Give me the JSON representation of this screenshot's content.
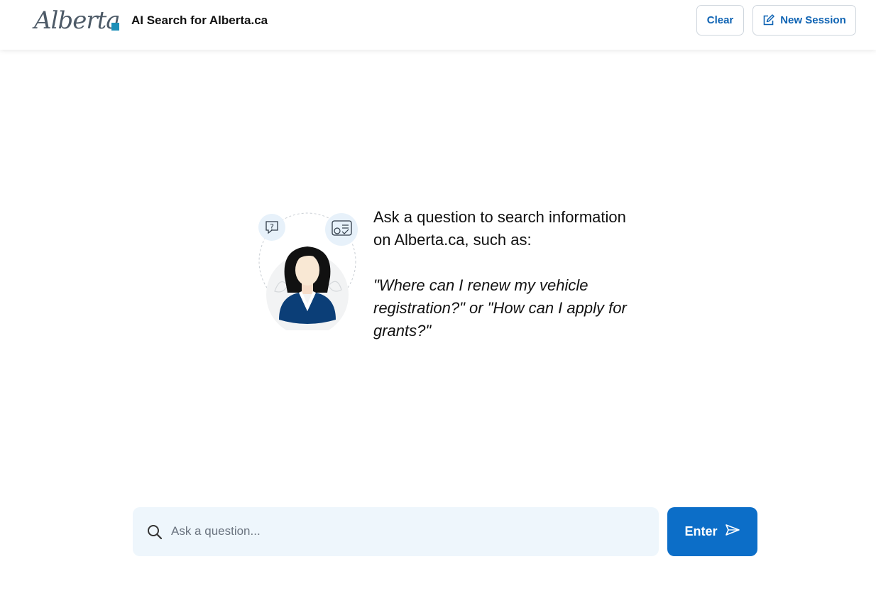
{
  "header": {
    "logo_text": "Alberta",
    "app_title": "AI Search for Alberta.ca",
    "clear_label": "Clear",
    "new_session_label": "New Session",
    "new_session_icon": "edit-icon"
  },
  "intro": {
    "line1": "Ask a question to search information",
    "line2": "on Alberta.ca, such as:",
    "example": "\"Where can I renew my vehicle registration?\" or \"How can I apply for grants?\""
  },
  "search": {
    "placeholder": "Ask a question...",
    "value": "",
    "icon": "search-icon"
  },
  "enter_button": {
    "label": "Enter",
    "icon": "send-icon"
  },
  "colors": {
    "accent": "#0c6ec8",
    "link_blue": "#0e63b3",
    "logo_square": "#1c8fb8",
    "search_bg": "#eef6fc",
    "avatar_jacket": "#0b3e77"
  }
}
